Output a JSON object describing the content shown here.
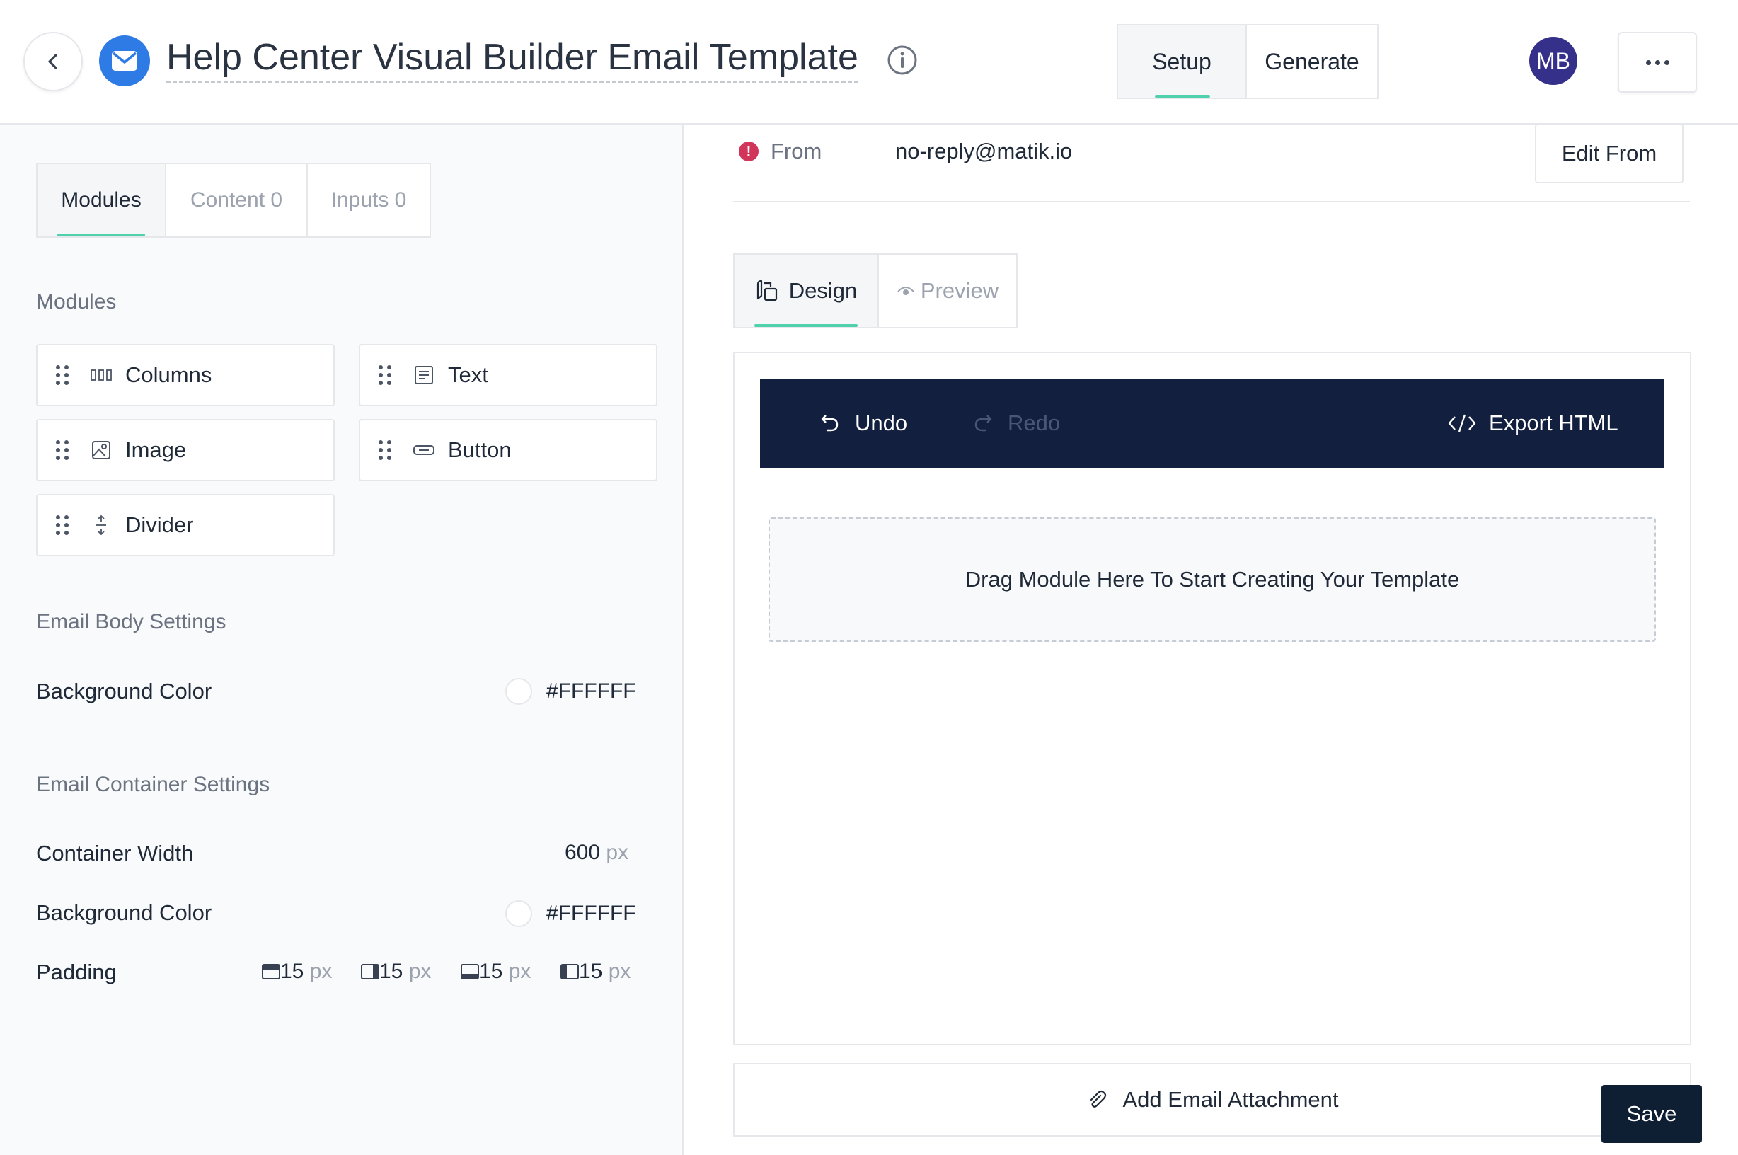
{
  "header": {
    "title": "Help Center Visual Builder Email Template",
    "tabs": [
      {
        "label": "Setup",
        "active": true
      },
      {
        "label": "Generate",
        "active": false
      }
    ],
    "avatar_initials": "MB",
    "avatar_color": "#35308a",
    "accent_color": "#4fd1ae",
    "icons": [
      "chevron-left-icon",
      "mail-icon",
      "info-icon",
      "more-horizontal-icon"
    ]
  },
  "left_panel": {
    "tabs": [
      {
        "label": "Modules",
        "active": true
      },
      {
        "label": "Content 0",
        "active": false
      },
      {
        "label": "Inputs 0",
        "active": false
      }
    ],
    "modules_heading": "Modules",
    "modules": [
      {
        "label": "Columns",
        "icon": "columns-icon"
      },
      {
        "label": "Text",
        "icon": "text-icon"
      },
      {
        "label": "Image",
        "icon": "image-icon"
      },
      {
        "label": "Button",
        "icon": "button-icon"
      },
      {
        "label": "Divider",
        "icon": "divider-icon"
      }
    ],
    "email_body_heading": "Email Body Settings",
    "body_bg_label": "Background Color",
    "body_bg_value": "#FFFFFF",
    "container_heading": "Email Container Settings",
    "container_width_label": "Container Width",
    "container_width_value": "600",
    "unit": "px",
    "container_bg_label": "Background Color",
    "container_bg_value": "#FFFFFF",
    "padding_label": "Padding",
    "padding": [
      {
        "side": "top",
        "value": "15",
        "icon": "padding-top-icon"
      },
      {
        "side": "right",
        "value": "15",
        "icon": "padding-right-icon"
      },
      {
        "side": "bottom",
        "value": "15",
        "icon": "padding-bottom-icon"
      },
      {
        "side": "left",
        "value": "15",
        "icon": "padding-left-icon"
      }
    ]
  },
  "right_panel": {
    "from_label": "From",
    "from_value": "no-reply@matik.io",
    "edit_from_label": "Edit From",
    "alert_color": "#d1365a",
    "view_tabs": [
      {
        "label": "Design",
        "active": true,
        "icon": "design-icon"
      },
      {
        "label": "Preview",
        "active": false,
        "icon": "eye-icon"
      }
    ],
    "toolbar": {
      "background": "#131f3f",
      "undo_label": "Undo",
      "redo_label": "Redo",
      "export_label": "Export HTML"
    },
    "drop_zone_text": "Drag Module Here To Start Creating Your Template",
    "attachment_label": "Add Email Attachment",
    "save_label": "Save"
  }
}
